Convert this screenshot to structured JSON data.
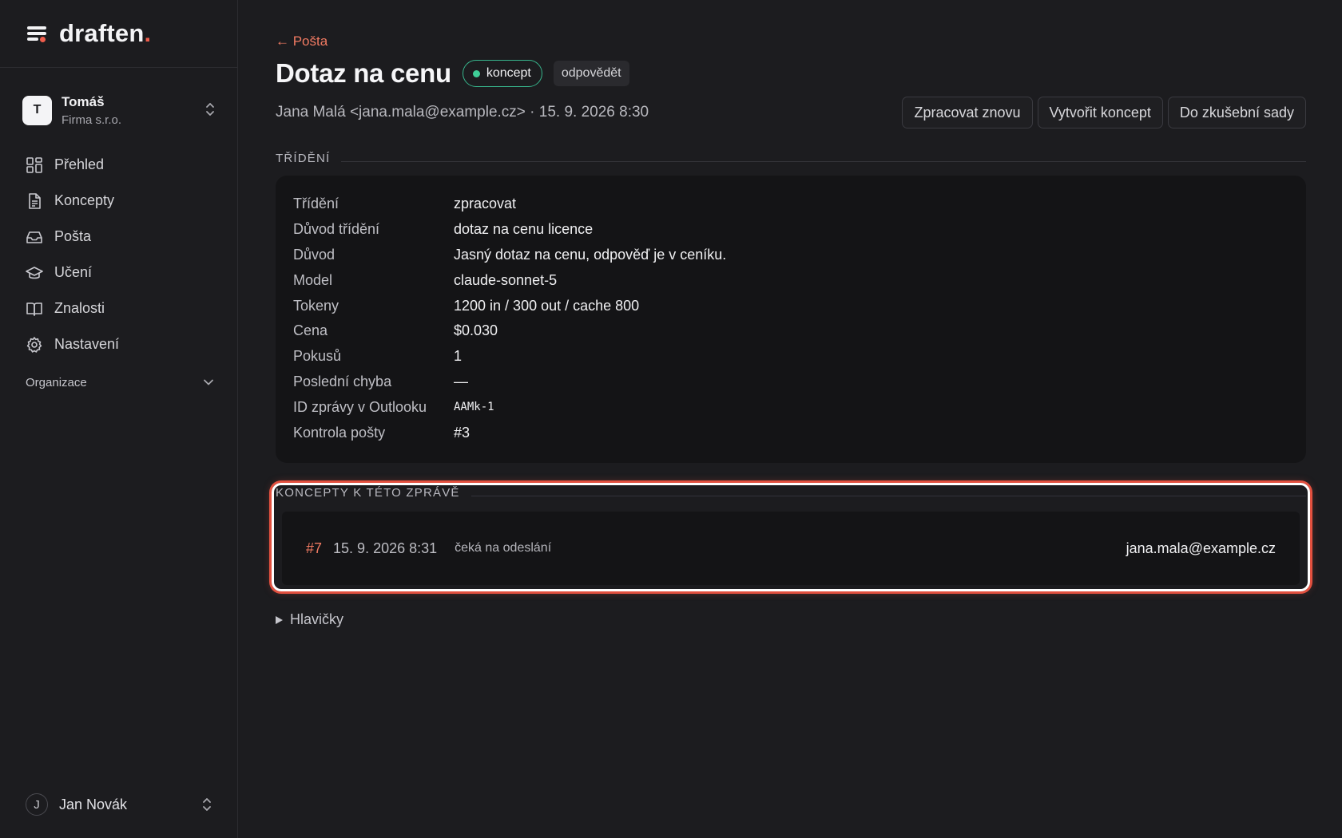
{
  "brand": {
    "name": "draften",
    "dot": "."
  },
  "account": {
    "initial": "T",
    "name": "Tomáš",
    "org": "Firma s.r.o."
  },
  "nav": {
    "items": [
      {
        "label": "Přehled",
        "icon": "dashboard-icon"
      },
      {
        "label": "Koncepty",
        "icon": "document-icon"
      },
      {
        "label": "Pošta",
        "icon": "inbox-icon"
      },
      {
        "label": "Učení",
        "icon": "graduation-cap-icon"
      },
      {
        "label": "Znalosti",
        "icon": "book-icon"
      },
      {
        "label": "Nastavení",
        "icon": "gear-icon"
      }
    ],
    "org_section": "Organizace"
  },
  "user": {
    "initial": "J",
    "name": "Jan Novák"
  },
  "page": {
    "back_link": "← Pošta",
    "title": "Dotaz na cenu",
    "status_badge": "koncept",
    "tag_badge": "odpovědět",
    "meta": "Jana Malá <jana.mala@example.cz> · 15. 9. 2026 8:30",
    "actions": [
      "Zpracovat znovu",
      "Vytvořit koncept",
      "Do zkušební sady"
    ]
  },
  "triage": {
    "heading": "TŘÍDĚNÍ",
    "rows": [
      {
        "key": "Třídění",
        "value": "zpracovat"
      },
      {
        "key": "Důvod třídění",
        "value": "dotaz na cenu licence"
      },
      {
        "key": "Důvod",
        "value": "Jasný dotaz na cenu, odpověď je v ceníku."
      },
      {
        "key": "Model",
        "value": "claude-sonnet-5"
      },
      {
        "key": "Tokeny",
        "value": "1200 in / 300 out / cache 800"
      },
      {
        "key": "Cena",
        "value": "$0.030"
      },
      {
        "key": "Pokusů",
        "value": "1"
      },
      {
        "key": "Poslední chyba",
        "value": "—"
      },
      {
        "key": "ID zprávy v Outlooku",
        "value": "AAMk-1"
      },
      {
        "key": "Kontrola pošty",
        "value": "#3"
      }
    ]
  },
  "drafts": {
    "heading": "KONCEPTY K TÉTO ZPRÁVĚ",
    "items": [
      {
        "id": "#7",
        "date": "15. 9. 2026 8:31",
        "status": "čeká na odeslání",
        "to": "jana.mala@example.cz"
      }
    ]
  },
  "headers_toggle": "Hlavičky",
  "colors": {
    "accent": "#f07a62",
    "status_green": "#3fcf98",
    "highlight_red": "#e2503f",
    "background": "#1c1c1f",
    "card": "#141416"
  }
}
